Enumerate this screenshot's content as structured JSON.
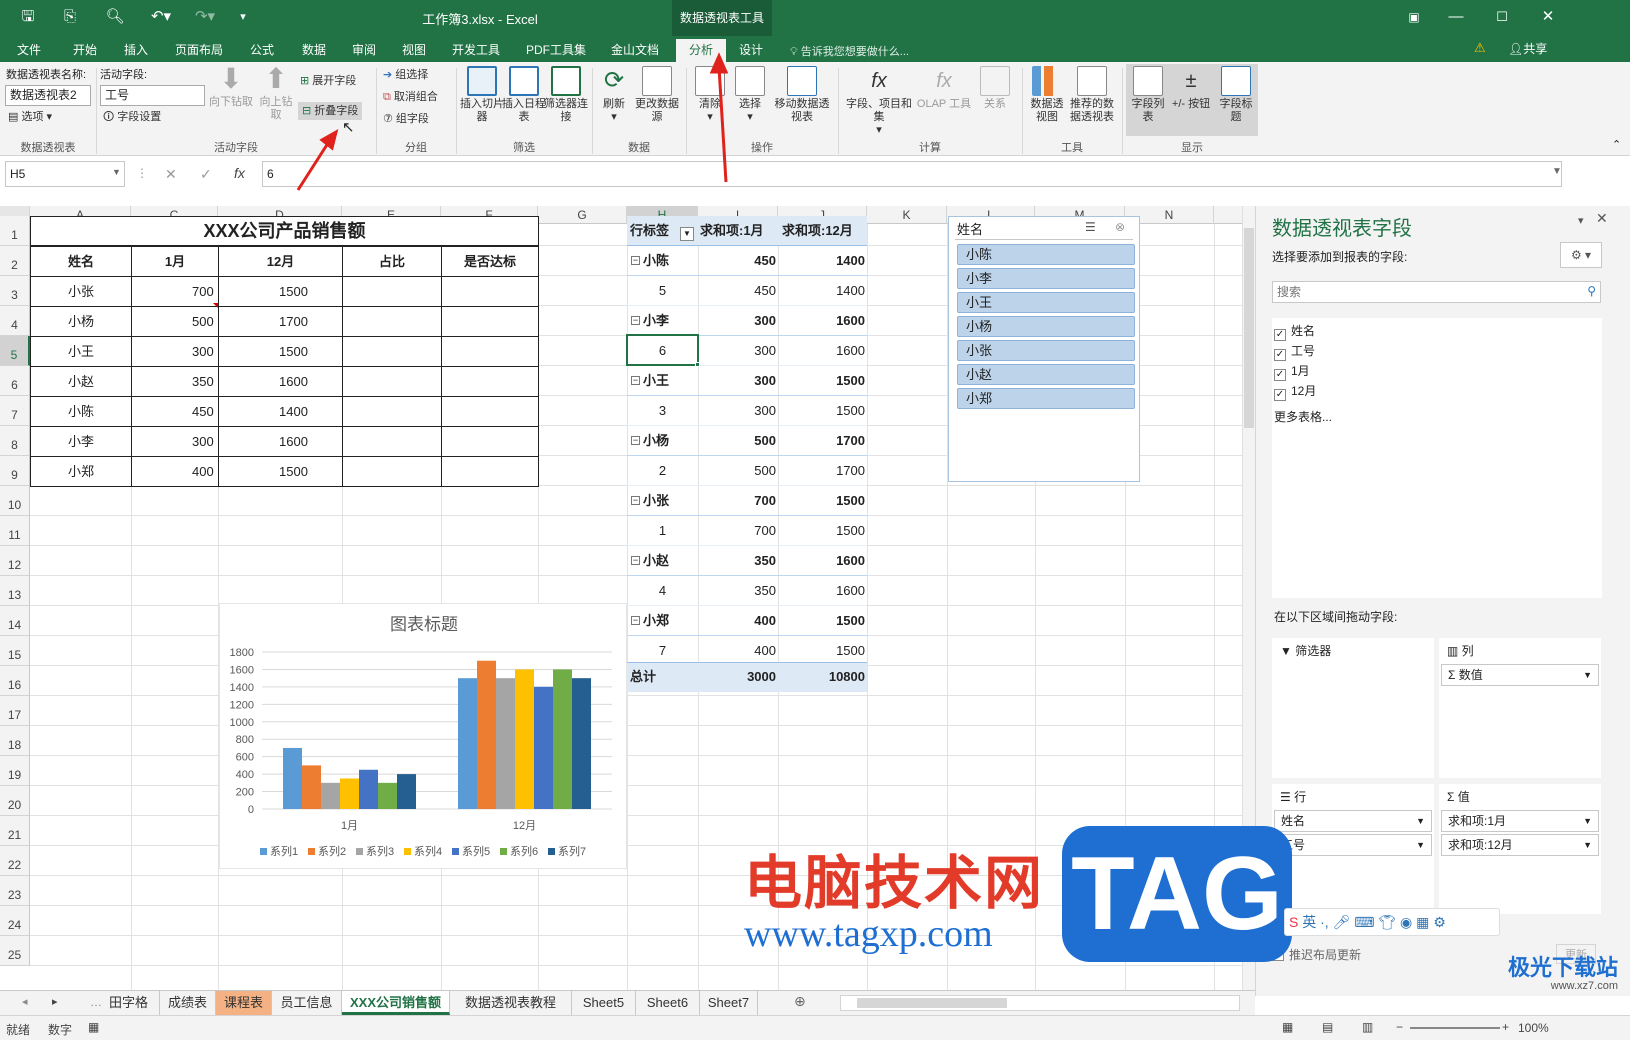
{
  "app": {
    "window_title": "工作簿3.xlsx - Excel",
    "context_tool": "数据透视表工具",
    "share": "共享",
    "tell_me": "告诉我您想要做什么..."
  },
  "ribbon_tabs": [
    "文件",
    "开始",
    "插入",
    "页面布局",
    "公式",
    "数据",
    "审阅",
    "视图",
    "开发工具",
    "PDF工具集",
    "金山文档",
    "分析",
    "设计"
  ],
  "active_tab": "分析",
  "ribbon": {
    "pt_name_label": "数据透视表名称:",
    "pt_name_value": "数据透视表2",
    "options": "选项",
    "group_pivot": "数据透视表",
    "active_field_label": "活动字段:",
    "active_field_value": "工号",
    "field_settings": "字段设置",
    "drill_down": "向下钻取",
    "drill_up": "向上钻取",
    "expand_field": "展开字段",
    "collapse_field": "折叠字段",
    "group_active": "活动字段",
    "group_select": "组选择",
    "ungroup": "取消组合",
    "group_field": "组字段",
    "group_group": "分组",
    "insert_slicer": "插入切片器",
    "insert_timeline": "插入日程表",
    "filter_conn": "筛选器连接",
    "group_filter": "筛选",
    "refresh": "刷新",
    "change_source": "更改数据源",
    "group_data": "数据",
    "clear": "清除",
    "select": "选择",
    "move_pt": "移动数据透视表",
    "group_actions": "操作",
    "fields_items": "字段、项目和集",
    "olap": "OLAP 工具",
    "relations": "关系",
    "group_calc": "计算",
    "pivot_chart": "数据透视图",
    "recommended": "推荐的数据透视表",
    "group_tools": "工具",
    "field_list": "字段列表",
    "plus_minus": "+/- 按钮",
    "field_headers": "字段标题",
    "group_show": "显示"
  },
  "formula_bar": {
    "name_box": "H5",
    "value": "6"
  },
  "columns": [
    "A",
    "C",
    "D",
    "E",
    "F",
    "G",
    "H",
    "I",
    "J",
    "K",
    "L",
    "M",
    "N"
  ],
  "selected_column": "H",
  "rows": [
    "1",
    "2",
    "3",
    "4",
    "5",
    "6",
    "7",
    "8",
    "9",
    "10",
    "11",
    "12",
    "13",
    "14",
    "15",
    "16",
    "17",
    "18",
    "19",
    "20",
    "21",
    "22",
    "23",
    "24",
    "25"
  ],
  "selected_row": "5",
  "table": {
    "title": "XXX公司产品销售额",
    "headers": [
      "姓名",
      "1月",
      "12月",
      "占比",
      "是否达标"
    ],
    "rows": [
      [
        "小张",
        "700",
        "1500"
      ],
      [
        "小杨",
        "500",
        "1700"
      ],
      [
        "小王",
        "300",
        "1500"
      ],
      [
        "小赵",
        "350",
        "1600"
      ],
      [
        "小陈",
        "450",
        "1400"
      ],
      [
        "小李",
        "300",
        "1600"
      ],
      [
        "小郑",
        "400",
        "1500"
      ]
    ]
  },
  "pivot": {
    "headers": [
      "行标签",
      "求和项:1月",
      "求和项:12月"
    ],
    "rows": [
      [
        "小陈",
        "450",
        "1400",
        "group"
      ],
      [
        "5",
        "450",
        "1400",
        "item"
      ],
      [
        "小李",
        "300",
        "1600",
        "group"
      ],
      [
        "6",
        "300",
        "1600",
        "item"
      ],
      [
        "小王",
        "300",
        "1500",
        "group"
      ],
      [
        "3",
        "300",
        "1500",
        "item"
      ],
      [
        "小杨",
        "500",
        "1700",
        "group"
      ],
      [
        "2",
        "500",
        "1700",
        "item"
      ],
      [
        "小张",
        "700",
        "1500",
        "group"
      ],
      [
        "1",
        "700",
        "1500",
        "item"
      ],
      [
        "小赵",
        "350",
        "1600",
        "group"
      ],
      [
        "4",
        "350",
        "1600",
        "item"
      ],
      [
        "小郑",
        "400",
        "1500",
        "group"
      ],
      [
        "7",
        "400",
        "1500",
        "item"
      ]
    ],
    "total": [
      "总计",
      "3000",
      "10800"
    ]
  },
  "slicer": {
    "title": "姓名",
    "items": [
      "小陈",
      "小李",
      "小王",
      "小杨",
      "小张",
      "小赵",
      "小郑"
    ]
  },
  "chart_data": {
    "type": "bar",
    "title": "图表标题",
    "categories": [
      "1月",
      "12月"
    ],
    "series": [
      {
        "name": "系列1",
        "values": [
          700,
          1500
        ],
        "color": "#5b9bd5"
      },
      {
        "name": "系列2",
        "values": [
          500,
          1700
        ],
        "color": "#ed7d31"
      },
      {
        "name": "系列3",
        "values": [
          300,
          1500
        ],
        "color": "#a5a5a5"
      },
      {
        "name": "系列4",
        "values": [
          350,
          1600
        ],
        "color": "#ffc000"
      },
      {
        "name": "系列5",
        "values": [
          450,
          1400
        ],
        "color": "#4472c4"
      },
      {
        "name": "系列6",
        "values": [
          300,
          1600
        ],
        "color": "#70ad47"
      },
      {
        "name": "系列7",
        "values": [
          400,
          1500
        ],
        "color": "#255e91"
      }
    ],
    "ylim": [
      0,
      1800
    ],
    "yticks": [
      "0",
      "200",
      "400",
      "600",
      "800",
      "1000",
      "1200",
      "1400",
      "1600",
      "1800"
    ],
    "legend": "bottom",
    "grid": true
  },
  "field_pane": {
    "title": "数据透视表字段",
    "subtitle": "选择要添加到报表的字段:",
    "search_placeholder": "搜索",
    "fields": [
      "姓名",
      "工号",
      "1月",
      "12月"
    ],
    "more_tables": "更多表格...",
    "drag_label": "在以下区域间拖动字段:",
    "filters": "筛选器",
    "columns": "列",
    "rows_label": "行",
    "values_label": "值",
    "col_item": "Σ 数值",
    "row_items": [
      "姓名",
      "工号"
    ],
    "value_items": [
      "求和项:1月",
      "求和项:12月"
    ],
    "defer": "推迟布局更新",
    "update": "更新"
  },
  "sheet_tabs": [
    "田字格",
    "成绩表",
    "课程表",
    "员工信息",
    "XXX公司销售额",
    "数据透视表教程",
    "Sheet5",
    "Sheet6",
    "Sheet7"
  ],
  "active_sheet": "XXX公司销售额",
  "status": {
    "ready": "就绪",
    "mode": "数字",
    "zoom": "100%"
  },
  "watermark": {
    "site_text": "电脑技术网",
    "url": "www.tagxp.com",
    "logo": "TAG",
    "corner": "极光下载站",
    "corner_url": "www.xz7.com"
  },
  "colors": {
    "excel_green": "#217346",
    "pivot_header": "#dde9f5",
    "slicer_item": "#bcd3ea",
    "arrow_red": "#e0221c"
  }
}
